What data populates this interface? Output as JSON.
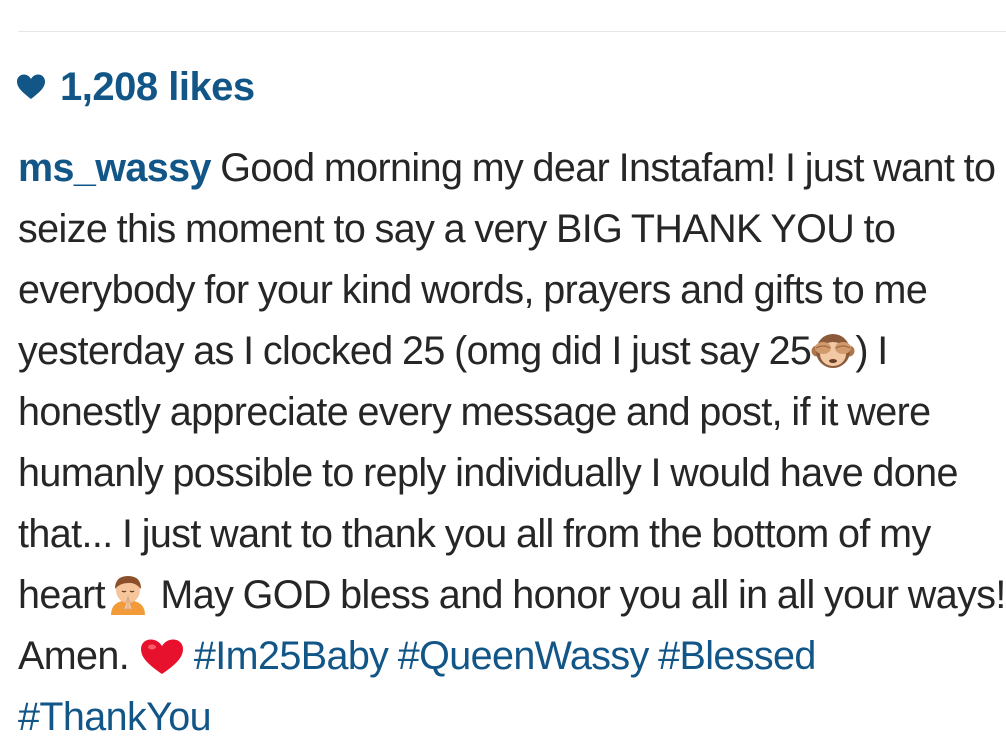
{
  "likes": {
    "icon": "heart-icon",
    "count_label": "1,208 likes"
  },
  "caption": {
    "username": "ms_wassy",
    "text_1": " Good morning my dear Instafam! I just want to seize this moment to say a very BIG THANK YOU to everybody for your kind words, prayers and gifts to me yesterday as I clocked 25 (omg did I just say 25",
    "emoji_1": "see-no-evil-monkey-icon",
    "text_2": ") I honestly appreciate every message and post, if it were humanly possible to reply individually I would have done that... I just want to thank you all from the bottom of my heart",
    "emoji_2": "folded-hands-person-icon",
    "text_3": " May GOD bless and honor you all in all your ways! Amen. ",
    "emoji_3": "red-heart-icon",
    "hashtags": [
      "#Im25Baby",
      "#QueenWassy",
      "#Blessed",
      "#ThankYou"
    ]
  },
  "colors": {
    "link_blue": "#125688",
    "text": "#262626",
    "heart_red": "#e8112d"
  }
}
